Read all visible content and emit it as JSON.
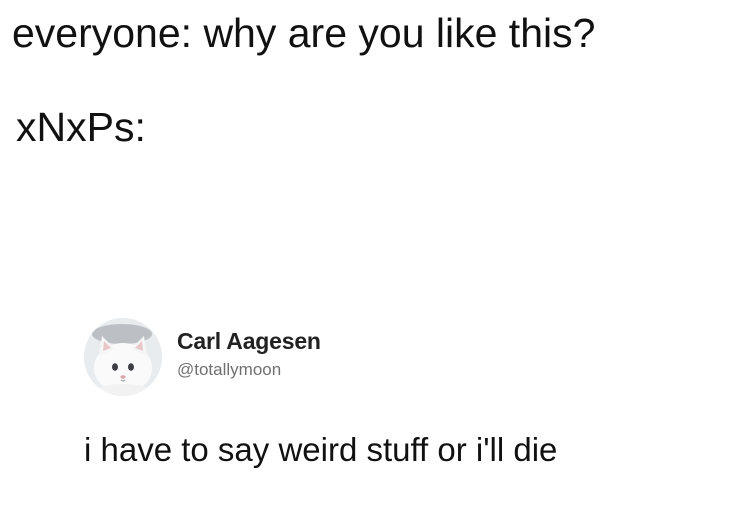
{
  "caption": {
    "line1": "everyone: why are you like this?",
    "line2": "xNxPs:"
  },
  "tweet": {
    "avatar": "white-cat-avatar",
    "display_name": "Carl Aagesen",
    "handle": "@totallymoon",
    "text": "i have to say weird stuff or i'll die"
  }
}
